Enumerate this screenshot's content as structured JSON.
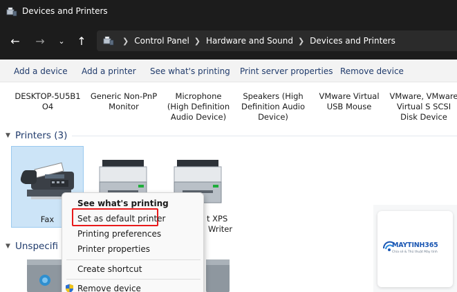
{
  "window": {
    "title": "Devices and Printers"
  },
  "nav": {
    "back_icon": "arrow-left-icon",
    "forward_icon": "arrow-right-icon",
    "recent_icon": "chevron-down-icon",
    "up_icon": "arrow-up-icon",
    "breadcrumbs": [
      "Control Panel",
      "Hardware and Sound",
      "Devices and Printers"
    ]
  },
  "commands": [
    "Add a device",
    "Add a printer",
    "See what's printing",
    "Print server properties",
    "Remove device"
  ],
  "devices": [
    {
      "lines": [
        "DESKTOP-5U5B1",
        "O4"
      ]
    },
    {
      "lines": [
        "Generic Non-PnP",
        "Monitor"
      ]
    },
    {
      "lines": [
        "Microphone",
        "(High Definition",
        "Audio Device)"
      ]
    },
    {
      "lines": [
        "Speakers (High",
        "Definition Audio",
        "Device)"
      ]
    },
    {
      "lines": [
        "VMware Virtual",
        "USB Mouse"
      ]
    },
    {
      "lines": [
        "VMware, VMware",
        "Virtual S SCSI",
        "Disk Device"
      ]
    }
  ],
  "printers_group": {
    "label": "Printers (3)"
  },
  "printers": [
    {
      "label": "Fax"
    },
    {
      "label": ""
    },
    {
      "label": "t XPS",
      "label_line2": "Writer"
    }
  ],
  "unspecified_group": {
    "label": "Unspecifi"
  },
  "context_menu": {
    "items": [
      {
        "label": "See what's printing",
        "bold": true
      },
      {
        "label": "Set as default printer",
        "highlighted": true
      },
      {
        "label": "Printing preferences"
      },
      {
        "label": "Printer properties"
      },
      {
        "label": "Create shortcut"
      },
      {
        "label": "Remove device",
        "icon": "shield-icon"
      }
    ]
  },
  "watermark": {
    "brand": "MAYTINH365",
    "tagline": "Chia sẻ & Thủ thuật Máy tính"
  },
  "colors": {
    "titlebar": "#1c1c1c",
    "link": "#1f3a6b",
    "selection": "#cce4f7",
    "highlight": "#e8191a",
    "brand": "#1b57b3"
  }
}
